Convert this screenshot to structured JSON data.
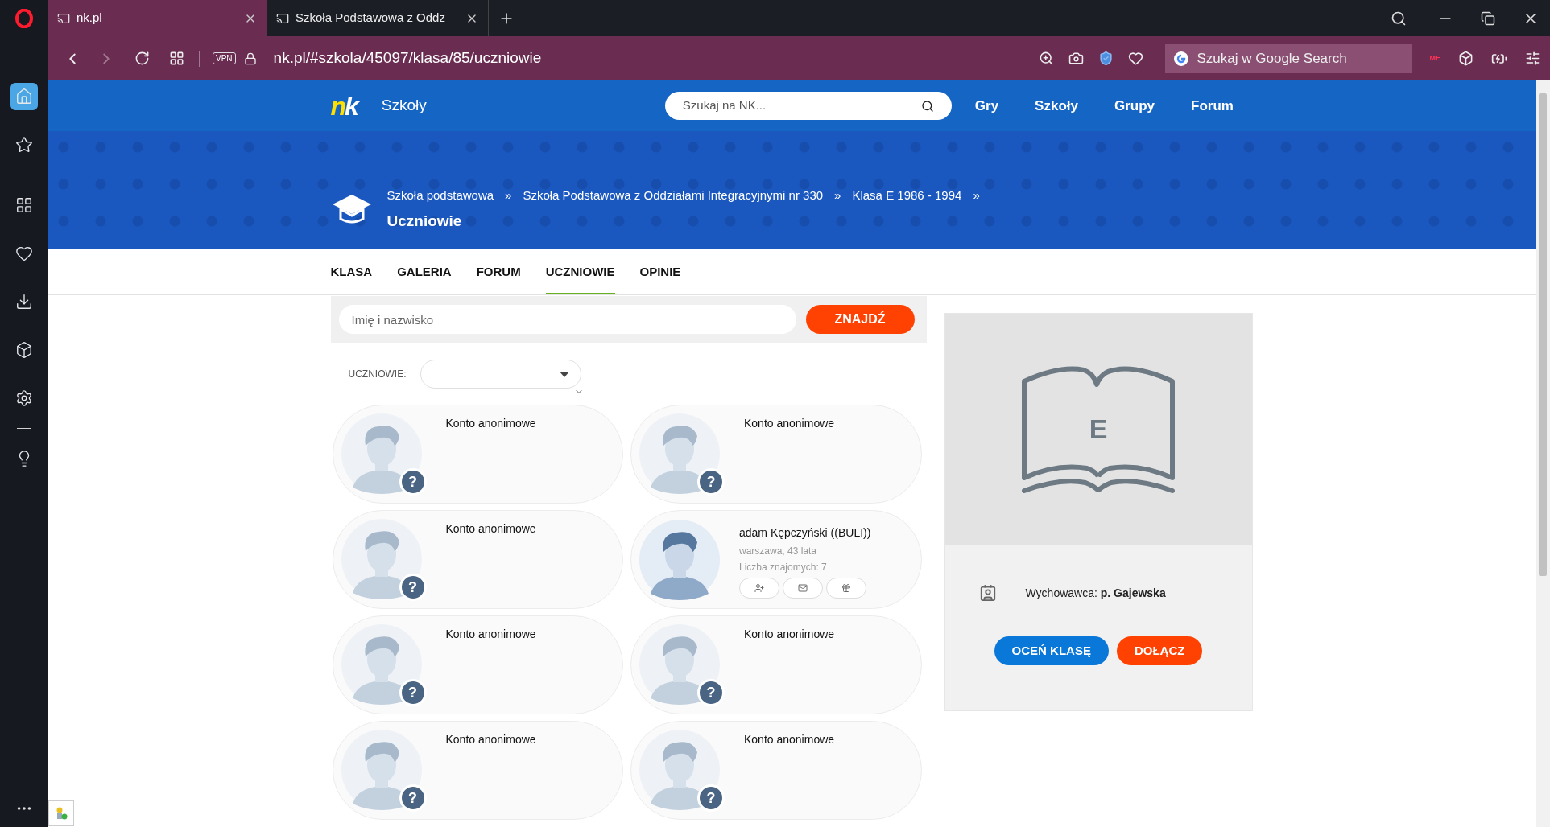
{
  "browser": {
    "tabs": [
      {
        "title": "nk.pl",
        "selected": true
      },
      {
        "title": "Szkoła Podstawowa z Oddz",
        "selected": false
      }
    ],
    "vpn": "VPN",
    "address": "nk.pl/#szkola/45097/klasa/85/uczniowie",
    "search_placeholder": "Szukaj w Google Search",
    "extension_badge": "ME"
  },
  "sidebar": {
    "items": [
      {
        "selected": true
      },
      {
        "selected": false
      },
      {
        "selected": false
      },
      {
        "selected": false
      },
      {
        "selected": false
      },
      {
        "selected": false
      },
      {
        "selected": false
      },
      {
        "selected": false
      }
    ]
  },
  "site": {
    "logo": [
      "n",
      "k"
    ],
    "section": "Szkoły",
    "search_placeholder": "Szukaj na NK...",
    "nav": [
      "Gry",
      "Szkoły",
      "Grupy",
      "Forum"
    ]
  },
  "breadcrumb": [
    {
      "label": "Szkoła podstawowa",
      "separator": "»"
    },
    {
      "label": "Szkoła Podstawowa z Oddziałami Integracyjnymi nr 330",
      "separator": "»"
    },
    {
      "label": "Klasa E 1986 - 1994",
      "separator": "»"
    }
  ],
  "page_title": "Uczniowie",
  "tabs": [
    {
      "label": "KLASA",
      "selected": false
    },
    {
      "label": "GALERIA",
      "selected": false
    },
    {
      "label": "FORUM",
      "selected": false
    },
    {
      "label": "UCZNIOWIE",
      "selected": true
    },
    {
      "label": "OPINIE",
      "selected": false
    }
  ],
  "search": {
    "placeholder": "Imię i nazwisko",
    "button": "ZNAJDŹ"
  },
  "filter": {
    "label": "UCZNIOWIE:"
  },
  "students": [
    {
      "kind": "anonymous",
      "name": "Konto anonimowe",
      "badge": "?"
    },
    {
      "kind": "anonymous",
      "name": "Konto anonimowe",
      "badge": "?"
    },
    {
      "kind": "anonymous",
      "name": "Konto anonimowe",
      "badge": "?"
    },
    {
      "kind": "profile",
      "name": "adam Kępczyński ((BULI))",
      "details": "warszawa, 43 lata",
      "friends": "Liczba znajomych: 7"
    },
    {
      "kind": "anonymous",
      "name": "Konto anonimowe",
      "badge": "?"
    },
    {
      "kind": "anonymous",
      "name": "Konto anonimowe",
      "badge": "?"
    },
    {
      "kind": "anonymous",
      "name": "Konto anonimowe",
      "badge": "?"
    },
    {
      "kind": "anonymous",
      "name": "Konto anonimowe",
      "badge": "?"
    }
  ],
  "class_card": {
    "letter": "E",
    "teacher": "Wychowawca: **p. Gajewska**",
    "buttons": [
      {
        "label": "OCEŃ KLASĘ",
        "kind": "primary"
      },
      {
        "label": "DOŁĄCZ",
        "kind": "accent"
      }
    ]
  }
}
